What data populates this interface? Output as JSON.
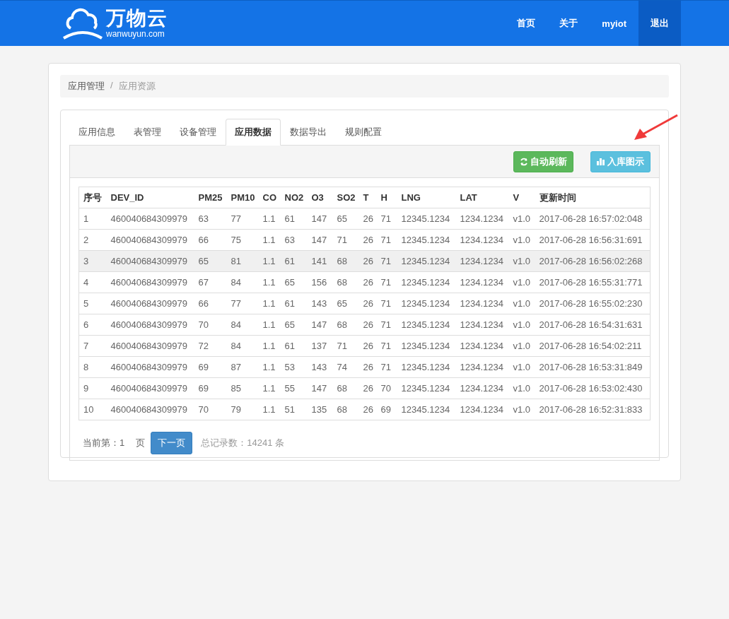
{
  "header": {
    "logo_title": "万物云",
    "logo_subtitle": "wanwuyun.com",
    "nav": [
      {
        "label": "首页",
        "selected": false
      },
      {
        "label": "关于",
        "selected": false
      },
      {
        "label": "myiot",
        "selected": false
      },
      {
        "label": "退出",
        "selected": true
      }
    ]
  },
  "breadcrumb": {
    "separator": "/",
    "items": [
      "应用管理",
      "应用资源"
    ]
  },
  "tabs": [
    {
      "label": "应用信息",
      "selected": false
    },
    {
      "label": "表管理",
      "selected": false
    },
    {
      "label": "设备管理",
      "selected": false
    },
    {
      "label": "应用数据",
      "selected": true
    },
    {
      "label": "数据导出",
      "selected": false
    },
    {
      "label": "规则配置",
      "selected": false
    }
  ],
  "toolbar": {
    "buttons": [
      {
        "kind": "refresh",
        "label": "自动刷新"
      },
      {
        "kind": "chart",
        "label": "入库图示"
      }
    ]
  },
  "table": {
    "columns": [
      "序号",
      "DEV_ID",
      "PM25",
      "PM10",
      "CO",
      "NO2",
      "O3",
      "SO2",
      "T",
      "H",
      "LNG",
      "LAT",
      "V",
      "更新时间"
    ],
    "rows": [
      {
        "highlighted": false,
        "cells": [
          "1",
          "460040684309979",
          "63",
          "77",
          "1.1",
          "61",
          "147",
          "65",
          "26",
          "71",
          "12345.1234",
          "1234.1234",
          "v1.0",
          "2017-06-28 16:57:02:048"
        ]
      },
      {
        "highlighted": false,
        "cells": [
          "2",
          "460040684309979",
          "66",
          "75",
          "1.1",
          "63",
          "147",
          "71",
          "26",
          "71",
          "12345.1234",
          "1234.1234",
          "v1.0",
          "2017-06-28 16:56:31:691"
        ]
      },
      {
        "highlighted": true,
        "cells": [
          "3",
          "460040684309979",
          "65",
          "81",
          "1.1",
          "61",
          "141",
          "68",
          "26",
          "71",
          "12345.1234",
          "1234.1234",
          "v1.0",
          "2017-06-28 16:56:02:268"
        ]
      },
      {
        "highlighted": false,
        "cells": [
          "4",
          "460040684309979",
          "67",
          "84",
          "1.1",
          "65",
          "156",
          "68",
          "26",
          "71",
          "12345.1234",
          "1234.1234",
          "v1.0",
          "2017-06-28 16:55:31:771"
        ]
      },
      {
        "highlighted": false,
        "cells": [
          "5",
          "460040684309979",
          "66",
          "77",
          "1.1",
          "61",
          "143",
          "65",
          "26",
          "71",
          "12345.1234",
          "1234.1234",
          "v1.0",
          "2017-06-28 16:55:02:230"
        ]
      },
      {
        "highlighted": false,
        "cells": [
          "6",
          "460040684309979",
          "70",
          "84",
          "1.1",
          "65",
          "147",
          "68",
          "26",
          "71",
          "12345.1234",
          "1234.1234",
          "v1.0",
          "2017-06-28 16:54:31:631"
        ]
      },
      {
        "highlighted": false,
        "cells": [
          "7",
          "460040684309979",
          "72",
          "84",
          "1.1",
          "61",
          "137",
          "71",
          "26",
          "71",
          "12345.1234",
          "1234.1234",
          "v1.0",
          "2017-06-28 16:54:02:211"
        ]
      },
      {
        "highlighted": false,
        "cells": [
          "8",
          "460040684309979",
          "69",
          "87",
          "1.1",
          "53",
          "143",
          "74",
          "26",
          "71",
          "12345.1234",
          "1234.1234",
          "v1.0",
          "2017-06-28 16:53:31:849"
        ]
      },
      {
        "highlighted": false,
        "cells": [
          "9",
          "460040684309979",
          "69",
          "85",
          "1.1",
          "55",
          "147",
          "68",
          "26",
          "70",
          "12345.1234",
          "1234.1234",
          "v1.0",
          "2017-06-28 16:53:02:430"
        ]
      },
      {
        "highlighted": false,
        "cells": [
          "10",
          "460040684309979",
          "70",
          "79",
          "1.1",
          "51",
          "135",
          "68",
          "26",
          "69",
          "12345.1234",
          "1234.1234",
          "v1.0",
          "2017-06-28 16:52:31:833"
        ]
      }
    ]
  },
  "pagination": {
    "current_label": "当前第：1",
    "page_unit": "页",
    "next_button": "下一页",
    "total": "总记录数：14241 条"
  }
}
